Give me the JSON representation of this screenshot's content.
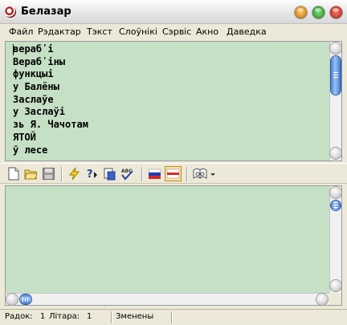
{
  "window": {
    "title": "Белазар",
    "colors": {
      "close": "#d9291c",
      "maximize": "#2fa23a",
      "minimize": "#f0a020",
      "pane_bg": "#c5e0c5",
      "scroll_thumb": "#5a8ee0"
    }
  },
  "menu": [
    "Файл",
    "Рэдактар",
    "Тэкст",
    "Слоўнікі",
    "Сэрвіс",
    "Акно",
    "Даведка"
  ],
  "editor_top": {
    "lines": [
      "верабʹі",
      "Верабʹіны",
      "функцыі",
      "у Балёны",
      "Заслаўе",
      "у Заслаўі",
      "зь Я. Чачотам",
      "ЯТОЙ",
      "ў лесе"
    ]
  },
  "toolbar": {
    "icons": [
      "new-document-icon",
      "open-folder-icon",
      "save-disk-icon",
      "lightning-convert-icon",
      "help-question-icon",
      "paste-document-icon",
      "spellcheck-abc-icon",
      "flag-russian-icon",
      "flag-belarusian-icon",
      "book-dictionary-icon",
      "dropdown-arrow-icon"
    ]
  },
  "editor_bottom": {
    "lines": []
  },
  "status": {
    "row_label": "Радок:",
    "row_value": "1",
    "letter_label": "Літара:",
    "letter_value": "1",
    "modified": "Зменены"
  }
}
